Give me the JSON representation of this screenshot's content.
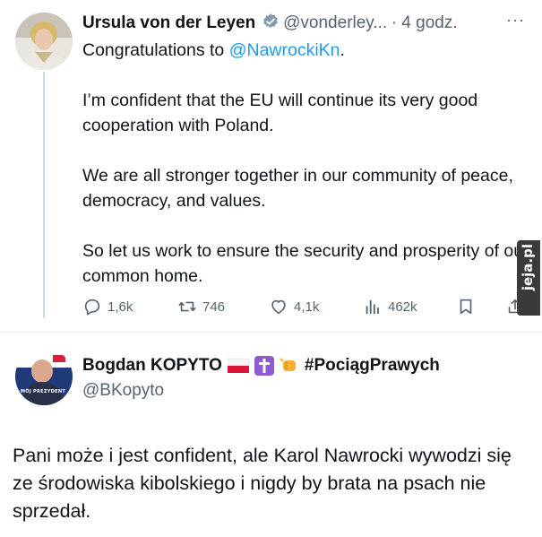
{
  "tweet1": {
    "author": "Ursula von der Leyen",
    "handle": "@vonderley...",
    "time": "· 4 godz.",
    "more": "···",
    "text_prefix": "Congratulations to ",
    "mention": "@NawrockiKn",
    "text_suffix": ".",
    "paragraphs": [
      "I’m confident that the EU will continue its very good cooperation with Poland.",
      "We are all stronger together in our community of peace, democracy, and values.",
      "So let us work to ensure the security and prosperity of our common home."
    ],
    "actions": {
      "replies": "1,6k",
      "retweets": "746",
      "likes": "4,1k",
      "views": "462k"
    }
  },
  "tweet2": {
    "author": "Bogdan KOPYTO",
    "hashtag": "#PociągPrawych",
    "handle": "@BKopyto",
    "avatar_caption": "MÓJ PREZYDENT",
    "text": "Pani może i jest confident, ale Karol Nawrocki wywodzi się ze środowiska kibolskiego i nigdy by brata na psach nie sprzedał."
  },
  "watermark": "jeja.pl",
  "colors": {
    "link": "#1d9bf0",
    "muted": "#536471",
    "text": "#0f1419",
    "verified_gold": "#829aab"
  },
  "icons": [
    "reply-icon",
    "retweet-icon",
    "like-icon",
    "views-icon",
    "bookmark-icon",
    "share-icon",
    "verified-icon",
    "more-icon"
  ]
}
